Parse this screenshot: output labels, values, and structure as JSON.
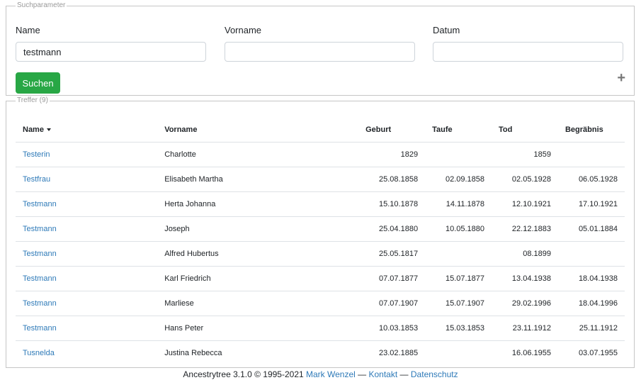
{
  "search": {
    "legend": "Suchparameter",
    "name_label": "Name",
    "name_value": "testmann",
    "vorname_label": "Vorname",
    "vorname_value": "",
    "datum_label": "Datum",
    "datum_value": "",
    "button_label": "Suchen",
    "expand_icon": "plus-icon"
  },
  "results": {
    "legend": "Treffer (9)",
    "columns": {
      "name": "Name",
      "vorname": "Vorname",
      "geburt": "Geburt",
      "taufe": "Taufe",
      "tod": "Tod",
      "begraebnis": "Begräbnis"
    },
    "sort_icon": "caret-down-icon",
    "rows": [
      {
        "name": "Testerin",
        "vorname": "Charlotte",
        "geburt": "1829",
        "taufe": "",
        "tod": "1859",
        "begraebnis": ""
      },
      {
        "name": "Testfrau",
        "vorname": "Elisabeth Martha",
        "geburt": "25.08.1858",
        "taufe": "02.09.1858",
        "tod": "02.05.1928",
        "begraebnis": "06.05.1928"
      },
      {
        "name": "Testmann",
        "vorname": "Herta Johanna",
        "geburt": "15.10.1878",
        "taufe": "14.11.1878",
        "tod": "12.10.1921",
        "begraebnis": "17.10.1921"
      },
      {
        "name": "Testmann",
        "vorname": "Joseph",
        "geburt": "25.04.1880",
        "taufe": "10.05.1880",
        "tod": "22.12.1883",
        "begraebnis": "05.01.1884"
      },
      {
        "name": "Testmann",
        "vorname": "Alfred Hubertus",
        "geburt": "25.05.1817",
        "taufe": "",
        "tod": "08.1899",
        "begraebnis": ""
      },
      {
        "name": "Testmann",
        "vorname": "Karl Friedrich",
        "geburt": "07.07.1877",
        "taufe": "15.07.1877",
        "tod": "13.04.1938",
        "begraebnis": "18.04.1938"
      },
      {
        "name": "Testmann",
        "vorname": "Marliese",
        "geburt": "07.07.1907",
        "taufe": "15.07.1907",
        "tod": "29.02.1996",
        "begraebnis": "18.04.1996"
      },
      {
        "name": "Testmann",
        "vorname": "Hans Peter",
        "geburt": "10.03.1853",
        "taufe": "15.03.1853",
        "tod": "23.11.1912",
        "begraebnis": "25.11.1912"
      },
      {
        "name": "Tusnelda",
        "vorname": "Justina Rebecca",
        "geburt": "23.02.1885",
        "taufe": "",
        "tod": "16.06.1955",
        "begraebnis": "03.07.1955"
      }
    ]
  },
  "footer": {
    "text": "Ancestrytree 3.1.0 © 1995-2021",
    "author": "Mark Wenzel",
    "sep1": "—",
    "kontakt": "Kontakt",
    "sep2": "—",
    "datenschutz": "Datenschutz"
  },
  "colors": {
    "link": "#2e7ab8",
    "button": "#28a745",
    "border": "#c6c6c6"
  }
}
